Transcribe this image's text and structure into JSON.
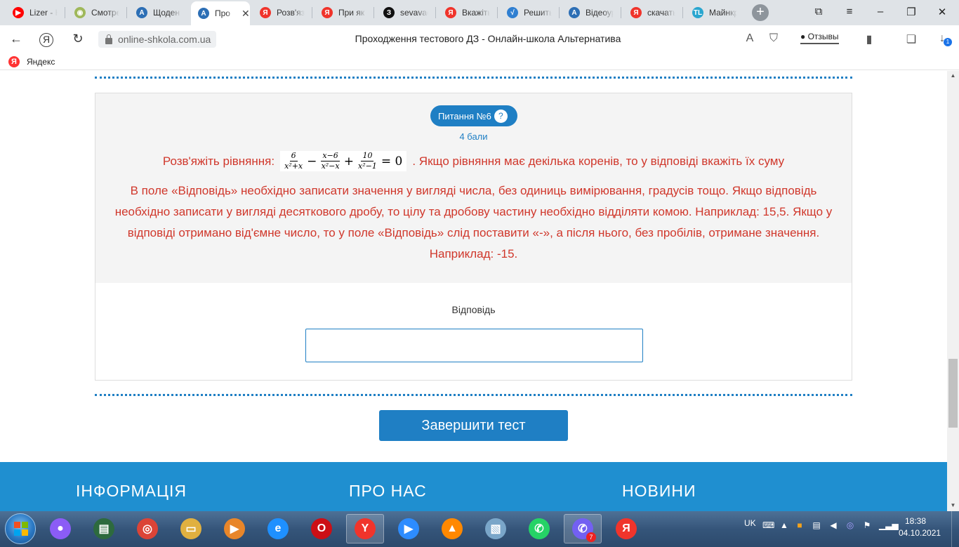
{
  "browser": {
    "tabs": [
      {
        "label": "Lizer - H",
        "icon": "youtube-icon",
        "color": "#ff0000",
        "glyph": "▶"
      },
      {
        "label": "Смотре",
        "icon": "film-reel-icon",
        "color": "#9fb85a",
        "glyph": "◉"
      },
      {
        "label": "Щоден",
        "icon": "diary-icon",
        "color": "#2d6fb5",
        "glyph": "A"
      },
      {
        "label": "Про",
        "icon": "diary-icon",
        "color": "#2d6fb5",
        "glyph": "A"
      },
      {
        "label": "Розв'яз",
        "icon": "yandex-icon",
        "color": "#f0342b",
        "glyph": "Я"
      },
      {
        "label": "При як",
        "icon": "yandex-icon",
        "color": "#f0342b",
        "glyph": "Я"
      },
      {
        "label": "sevavac",
        "icon": "znanija-icon",
        "color": "#111111",
        "glyph": "З"
      },
      {
        "label": "Вкажіть",
        "icon": "yandex-icon",
        "color": "#f0342b",
        "glyph": "Я"
      },
      {
        "label": "Решить",
        "icon": "math-icon",
        "color": "#2f7fd1",
        "glyph": "√"
      },
      {
        "label": "Відеоур",
        "icon": "diary-icon",
        "color": "#2d6fb5",
        "glyph": "A"
      },
      {
        "label": "скачать",
        "icon": "yandex-icon",
        "color": "#f0342b",
        "glyph": "Я"
      },
      {
        "label": "Майнкр",
        "icon": "tlauncher-icon",
        "color": "#2aa6cf",
        "glyph": "TL"
      }
    ],
    "active_tab_index": 3,
    "url": "online-shkola.com.ua",
    "page_title": "Проходження тестового ДЗ - Онлайн-школа Альтернатива",
    "reviews_label": "Отзывы",
    "download_badge": "1",
    "bookmarks": [
      {
        "label": "Яндекс",
        "icon": "yandex-icon"
      }
    ]
  },
  "question": {
    "badge_label": "Питання №6",
    "help_glyph": "?",
    "points": "4 бали",
    "task_prefix": "Розв'яжіть рівняння:",
    "formula": {
      "frac1": {
        "num": "6",
        "den": "x²+x"
      },
      "op1": "−",
      "frac2": {
        "num": "x−6",
        "den": "x²−x"
      },
      "op2": "+",
      "frac3": {
        "num": "10",
        "den": "x²−1"
      },
      "equals": "= 0"
    },
    "task_suffix": ". Якщо рівняння має декілька коренів, то у відповіді вкажіть їх суму",
    "instructions": "В поле «Відповідь» необхідно записати значення у вигляді числа, без одиниць вимірювання, градусів тощо. Якщо відповідь необхідно записати у вигляді десяткового дробу, то цілу та дробову частину необхідно відділяти комою. Наприклад: 15,5. Якщо у відповіді отримано від'ємне число, то у поле «Відповідь» слід поставити «-», а після нього, без пробілів, отримане значення. Наприклад: -15.",
    "answer_label": "Відповідь",
    "answer_value": ""
  },
  "actions": {
    "finish_label": "Завершити тест"
  },
  "footer": {
    "headings": [
      "ІНФОРМАЦІЯ",
      "ПРО НАС",
      "НОВИНИ"
    ]
  },
  "taskbar": {
    "apps": [
      {
        "name": "alice-icon",
        "color": "#8b5cf6",
        "glyph": "●"
      },
      {
        "name": "document-app-icon",
        "color": "#2d6a3e",
        "glyph": "▤"
      },
      {
        "name": "chrome-icon",
        "color": "#db4437",
        "glyph": "◎"
      },
      {
        "name": "file-explorer-icon",
        "color": "#e0b040",
        "glyph": "▭"
      },
      {
        "name": "media-player-icon",
        "color": "#e8862a",
        "glyph": "▶"
      },
      {
        "name": "internet-explorer-icon",
        "color": "#1e90ff",
        "glyph": "e"
      },
      {
        "name": "opera-icon",
        "color": "#cc0f16",
        "glyph": "O"
      },
      {
        "name": "yandex-browser-icon",
        "color": "#f0342b",
        "glyph": "Y"
      },
      {
        "name": "zoom-icon",
        "color": "#2d8cff",
        "glyph": "▶"
      },
      {
        "name": "vlc-icon",
        "color": "#ff8800",
        "glyph": "▲"
      },
      {
        "name": "files-app-icon",
        "color": "#7aa6c9",
        "glyph": "▧"
      },
      {
        "name": "whatsapp-icon",
        "color": "#25d366",
        "glyph": "✆"
      },
      {
        "name": "viber-icon",
        "color": "#7360f2",
        "glyph": "✆",
        "badge": "7"
      },
      {
        "name": "yandex-icon",
        "color": "#f0342b",
        "glyph": "Я"
      }
    ],
    "active_app_indices": [
      7,
      12
    ],
    "language": "UK",
    "time": "18:38",
    "date": "04.10.2021"
  }
}
